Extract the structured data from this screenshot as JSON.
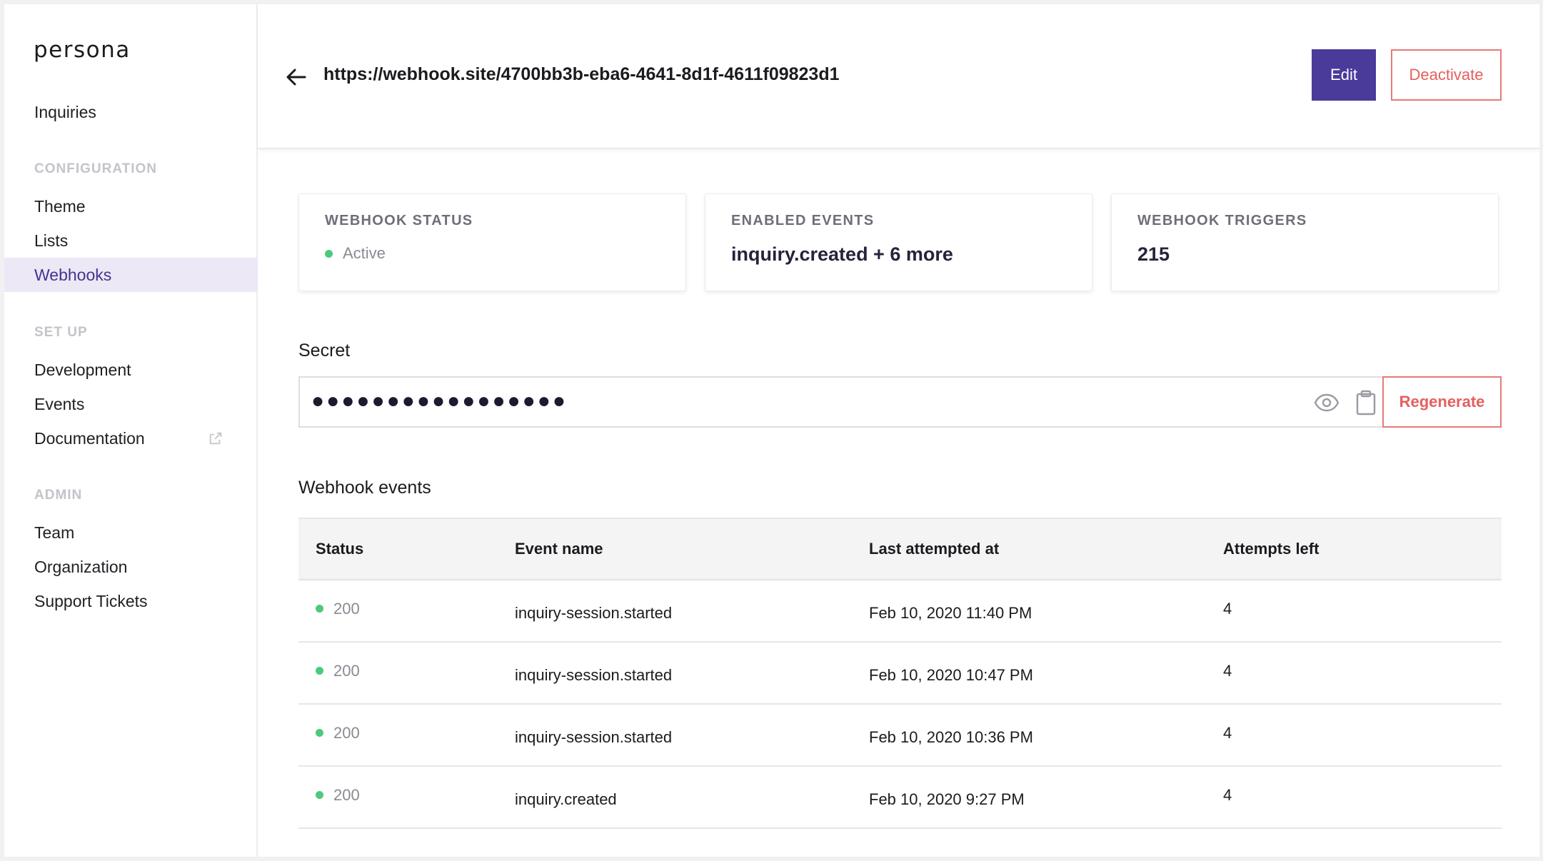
{
  "app": {
    "logo": "persona"
  },
  "sidebar": {
    "top_item": "Inquiries",
    "sections": [
      {
        "title": "CONFIGURATION",
        "items": [
          "Theme",
          "Lists",
          "Webhooks"
        ]
      },
      {
        "title": "SET UP",
        "items": [
          "Development",
          "Events",
          "Documentation"
        ]
      },
      {
        "title": "ADMIN",
        "items": [
          "Team",
          "Organization",
          "Support Tickets"
        ]
      }
    ],
    "active_item": "Webhooks",
    "external_link_icon": "external-link-icon"
  },
  "header": {
    "title": "https://webhook.site/4700bb3b-eba6-4641-8d1f-4611f09823d1",
    "back_icon": "arrow-left-icon",
    "edit_label": "Edit",
    "deactivate_label": "Deactivate"
  },
  "cards": {
    "status": {
      "label": "WEBHOOK STATUS",
      "value": "Active"
    },
    "events": {
      "label": "ENABLED EVENTS",
      "value": "inquiry.created + 6 more"
    },
    "triggers": {
      "label": "WEBHOOK TRIGGERS",
      "value": "215"
    }
  },
  "secret": {
    "heading": "Secret",
    "masked_value": "●●●●●●●●●●●●●●●●●",
    "show_icon": "eye-icon",
    "copy_icon": "clipboard-icon",
    "regenerate_label": "Regenerate"
  },
  "events_table": {
    "heading": "Webhook events",
    "columns": [
      "Status",
      "Event name",
      "Last attempted at",
      "Attempts left"
    ],
    "rows": [
      {
        "status": "200",
        "event": "inquiry-session.started",
        "time": "Feb 10, 2020 11:40 PM",
        "attempts": "4"
      },
      {
        "status": "200",
        "event": "inquiry-session.started",
        "time": "Feb 10, 2020 10:47 PM",
        "attempts": "4"
      },
      {
        "status": "200",
        "event": "inquiry-session.started",
        "time": "Feb 10, 2020 10:36 PM",
        "attempts": "4"
      },
      {
        "status": "200",
        "event": "inquiry.created",
        "time": "Feb 10, 2020 9:27 PM",
        "attempts": "4"
      }
    ]
  },
  "colors": {
    "accent": "#4a3a9a",
    "danger": "#e4605e",
    "success": "#4cc97d",
    "active_nav_bg": "#ece8f6"
  }
}
